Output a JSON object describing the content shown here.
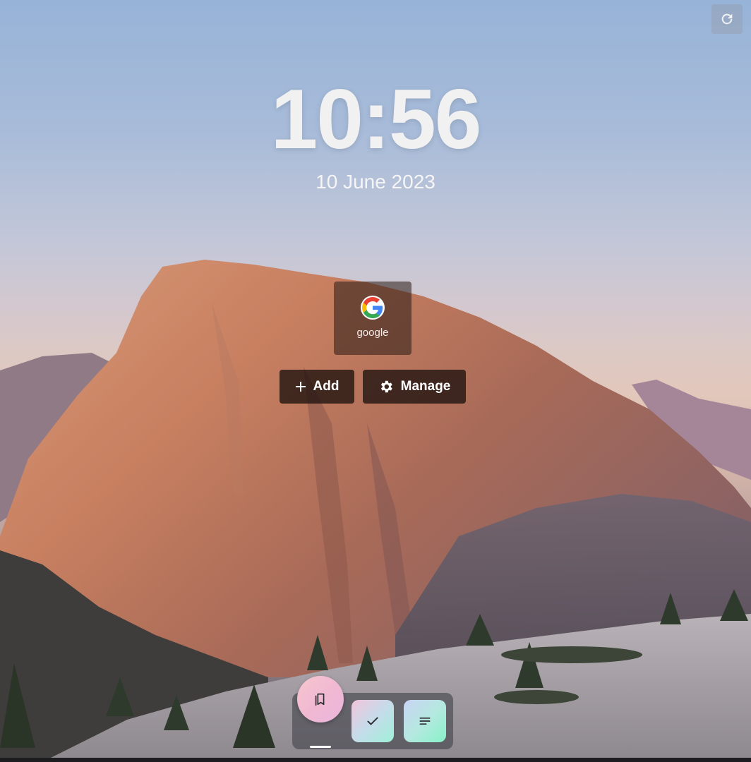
{
  "clock": {
    "time": "10:56",
    "date": "10 June 2023"
  },
  "shortcuts": [
    {
      "label": "google",
      "icon": "google-icon"
    }
  ],
  "actions": {
    "add_label": "Add",
    "add_icon": "plus-icon",
    "manage_label": "Manage",
    "manage_icon": "gear-icon"
  },
  "toolbar": {
    "reload_icon": "reload-icon"
  },
  "dock": {
    "items": [
      {
        "name": "bookmarks",
        "icon": "bookmarks-icon",
        "active": true
      },
      {
        "name": "todo",
        "icon": "checkmark-icon",
        "active": false
      },
      {
        "name": "notes",
        "icon": "notes-lines-icon",
        "active": false
      }
    ]
  },
  "colors": {
    "clock_text": "#f2f1f2",
    "button_bg": "#1e120e",
    "dock_bg": "#46464e"
  }
}
